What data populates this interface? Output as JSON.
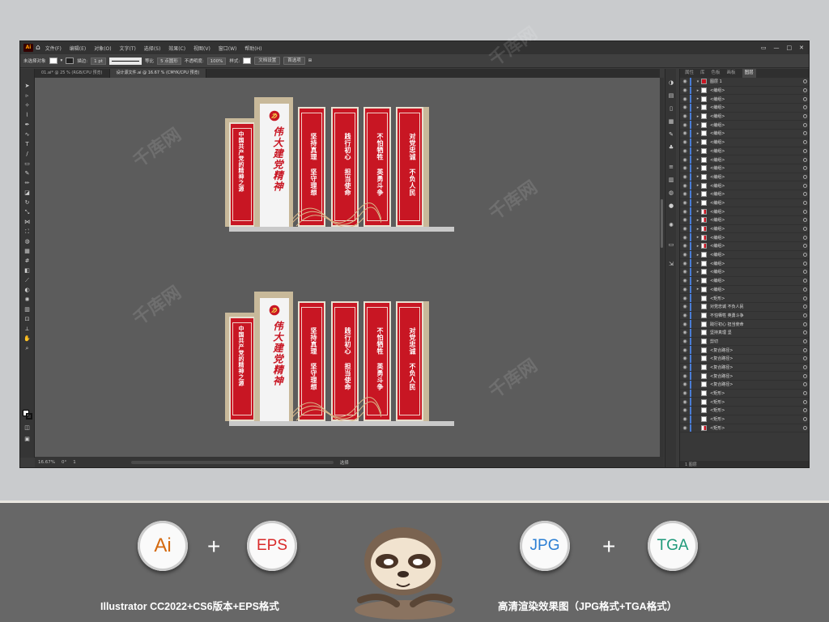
{
  "titlebar": {
    "app_badge": "Ai",
    "menu": [
      "文件(F)",
      "编辑(E)",
      "对象(O)",
      "文字(T)",
      "选择(S)",
      "效果(C)",
      "视图(V)",
      "窗口(W)",
      "帮助(H)"
    ]
  },
  "controlbar": {
    "selection": "未选择对象",
    "stroke_label": "描边:",
    "stroke_weight": "1 pt",
    "stroke_style": "等比",
    "brush": "5 点圆形",
    "opacity_label": "不透明度:",
    "opacity": "100%",
    "style_label": "样式:",
    "doc_setup": "文档设置",
    "prefs": "首选项"
  },
  "tabs": [
    {
      "label": "01.ai* @ 25 % (RGB/CPU 预览)",
      "active": false
    },
    {
      "label": "设计源文件.ai @ 16.67 % (CMYK/CPU 预览)",
      "active": true
    }
  ],
  "status": {
    "zoom": "16.67%",
    "angle": "0°",
    "page": "1",
    "tool": "选择"
  },
  "artwork": {
    "side_title": "中国共产党的精神之源",
    "main_title": "伟大建党精神",
    "panels": [
      {
        "col1": "坚持真理",
        "col2": "坚守理想"
      },
      {
        "col1": "践行初心",
        "col2": "担当使命"
      },
      {
        "col1": "不怕牺牲",
        "col2": "英勇斗争"
      },
      {
        "col1": "对党忠诚",
        "col2": "不负人民"
      }
    ]
  },
  "layers": {
    "tabs": [
      "属性",
      "库",
      "色板",
      "画板",
      "图层"
    ],
    "top_layer": "图层 1",
    "rows": [
      "<编组>",
      "<编组>",
      "<编组>",
      "<编组>",
      "<编组>",
      "<编组>",
      "<编组>",
      "<编组>",
      "<编组>",
      "<编组>",
      "<编组>",
      "<编组>",
      "<编组>",
      "<编组>",
      "<编组>",
      "<编组>",
      "<编组>",
      "<编组>",
      "<编组>",
      "<编组>",
      "<编组>",
      "<编组>",
      "<编组>",
      "<编组>",
      "<矩形>",
      "对党忠诚 不负人民",
      "不怕牺牲 英勇斗争",
      "践行初心 担当使命",
      "坚持真理 坚",
      "剪切",
      "<复合路径>",
      "<复合路径>",
      "<复合路径>",
      "<复合路径>",
      "<复合路径>",
      "<矩形>",
      "<矩形>",
      "<矩形>",
      "<矩形>",
      "<矩形>"
    ],
    "footer": "1 图层"
  },
  "banner": {
    "badge_ai": "Ai",
    "badge_eps": "EPS",
    "badge_jpg": "JPG",
    "badge_tga": "TGA",
    "plus": "+",
    "caption_left": "Illustrator CC2022+CS6版本+EPS格式",
    "caption_right": "高清渲染效果图（JPG格式+TGA格式）"
  },
  "colors": {
    "party_red": "#c81623",
    "frame_beige": "#c8b99a",
    "ai_orange": "#d4690f",
    "eps_red": "#d92b2b",
    "jpg_blue": "#2c7fd4",
    "tga_green": "#1f9a7a"
  }
}
